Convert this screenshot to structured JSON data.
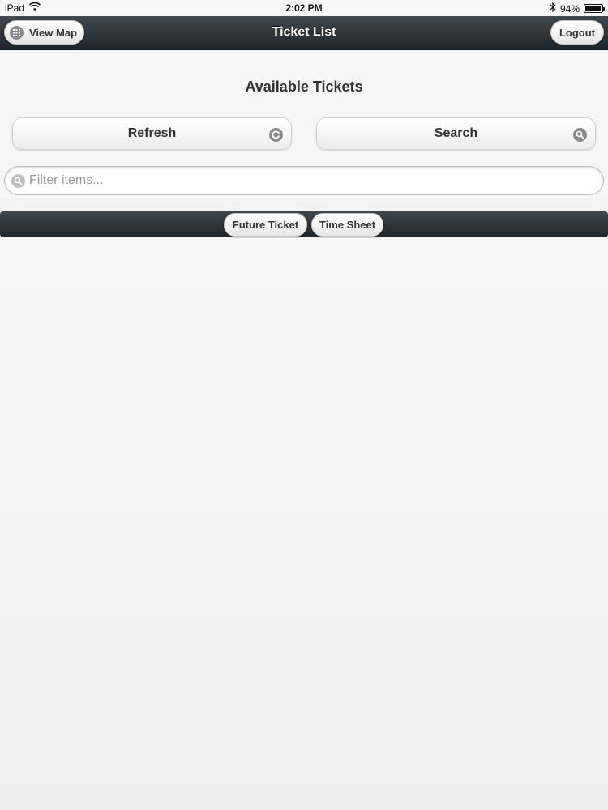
{
  "status_bar": {
    "device": "iPad",
    "time": "2:02 PM",
    "battery_text": "94%",
    "battery_level": 0.94,
    "icons": [
      "wifi-icon",
      "bluetooth-icon",
      "battery-icon"
    ]
  },
  "header": {
    "title": "Ticket List",
    "view_map_label": "View Map",
    "logout_label": "Logout"
  },
  "main": {
    "title": "Available Tickets",
    "refresh_label": "Refresh",
    "search_label": "Search",
    "filter": {
      "value": "",
      "placeholder": "Filter items..."
    }
  },
  "navbar": {
    "tabs": [
      {
        "label": "Future Ticket"
      },
      {
        "label": "Time Sheet"
      }
    ]
  },
  "colors": {
    "header_bg": "#2b3338",
    "page_bg": "#f3f3f3",
    "button_text": "#333333"
  }
}
